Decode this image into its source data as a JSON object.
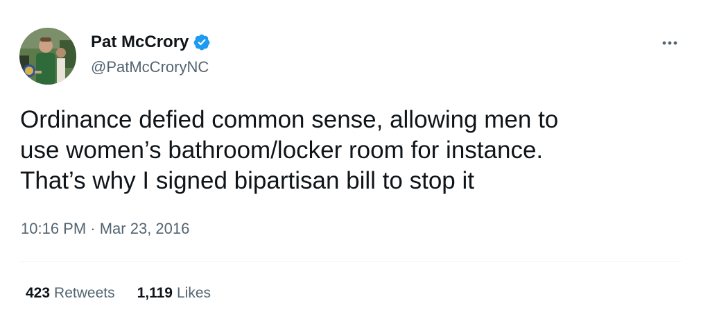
{
  "author": {
    "name": "Pat McCrory",
    "handle": "@PatMcCroryNC",
    "verified": true,
    "verified_color": "#1d9bf0"
  },
  "tweet": {
    "text": "Ordinance defied common sense, allowing men to\nuse women’s bathroom/locker room for instance.\nThat’s why I signed bipartisan bill to stop it",
    "timestamp": "10:16 PM · Mar 23, 2016"
  },
  "stats": {
    "retweets_count": "423",
    "retweets_label": "Retweets",
    "likes_count": "1,119",
    "likes_label": "Likes"
  },
  "icons": {
    "more": "more-options-icon",
    "verified": "verified-badge-icon"
  },
  "colors": {
    "text": "#0f1419",
    "secondary_text": "#536471",
    "divider": "#eff3f4",
    "background": "#ffffff"
  }
}
